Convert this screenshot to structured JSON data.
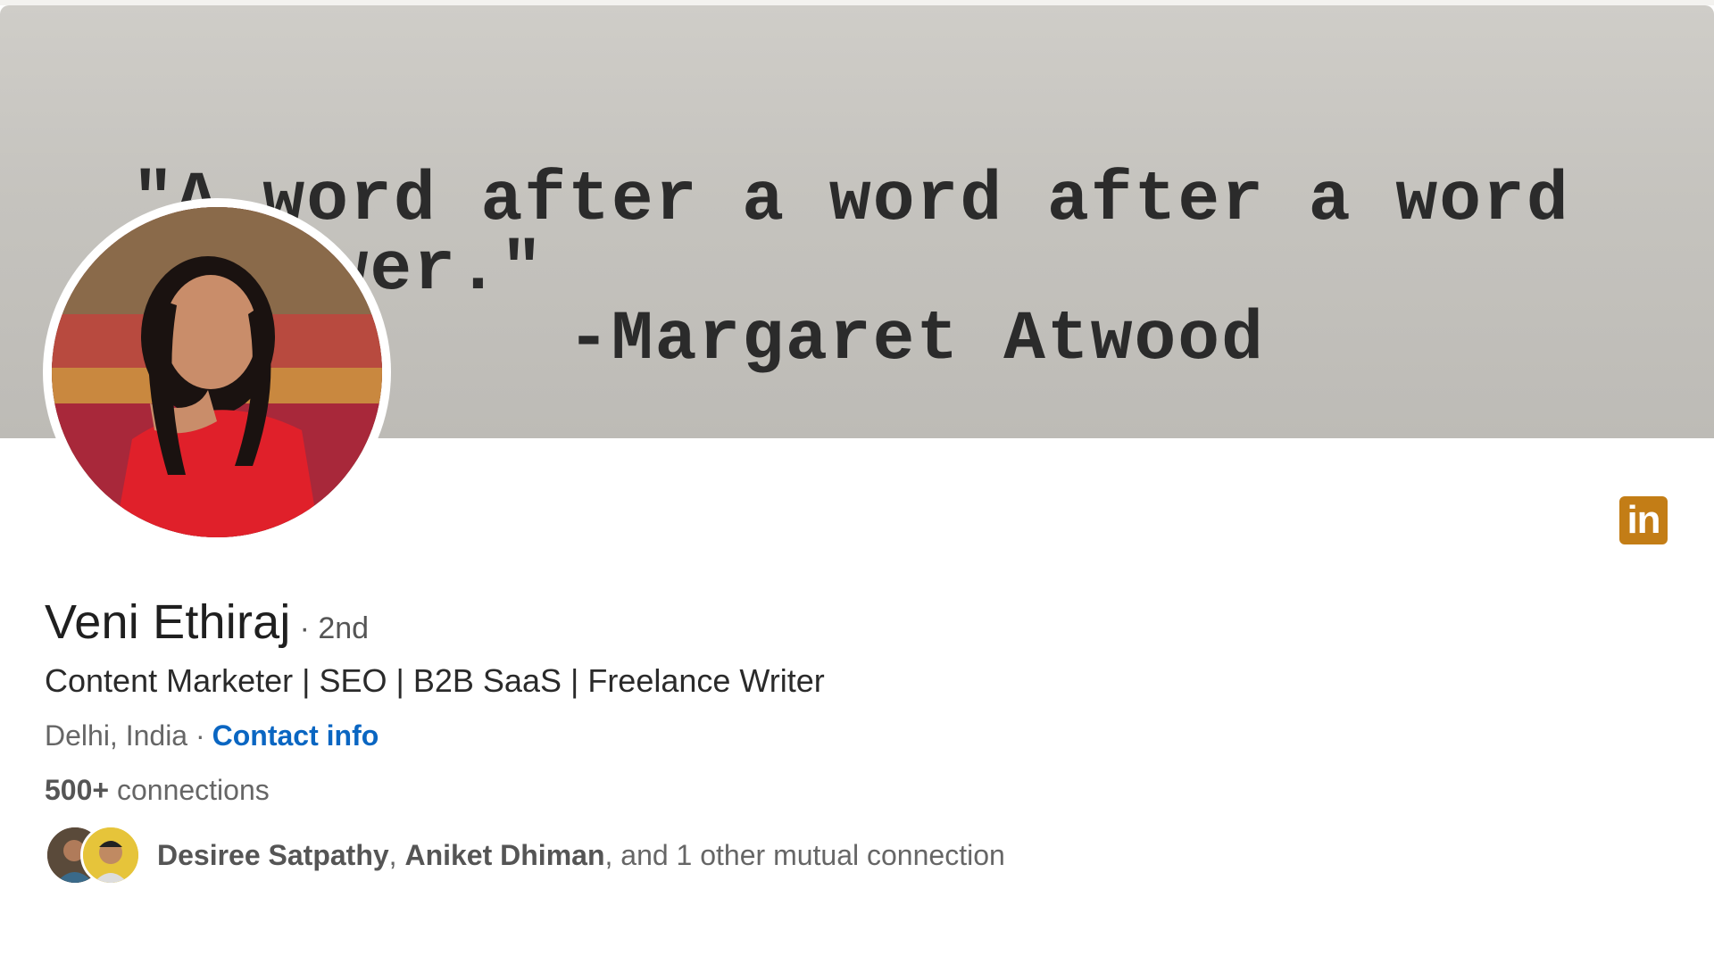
{
  "banner": {
    "quote_line1": "\"A word after a word after a word",
    "quote_line2": "power.\"",
    "quote_line3": "-Margaret Atwood"
  },
  "profile": {
    "name": "Veni Ethiraj",
    "degree": "· 2nd",
    "headline": "Content Marketer | SEO | B2B SaaS | Freelance Writer",
    "location": "Delhi, India ·",
    "contact_link": "Contact info",
    "connections_count": "500+",
    "connections_label": "connections"
  },
  "mutual": {
    "person1": "Desiree Satpathy",
    "separator": ",",
    "person2": "Aniket Dhiman",
    "rest": ", and 1 other mutual connection"
  },
  "badge": {
    "label": "in",
    "color": "#c37d16"
  },
  "colors": {
    "link": "#0a66c2"
  }
}
